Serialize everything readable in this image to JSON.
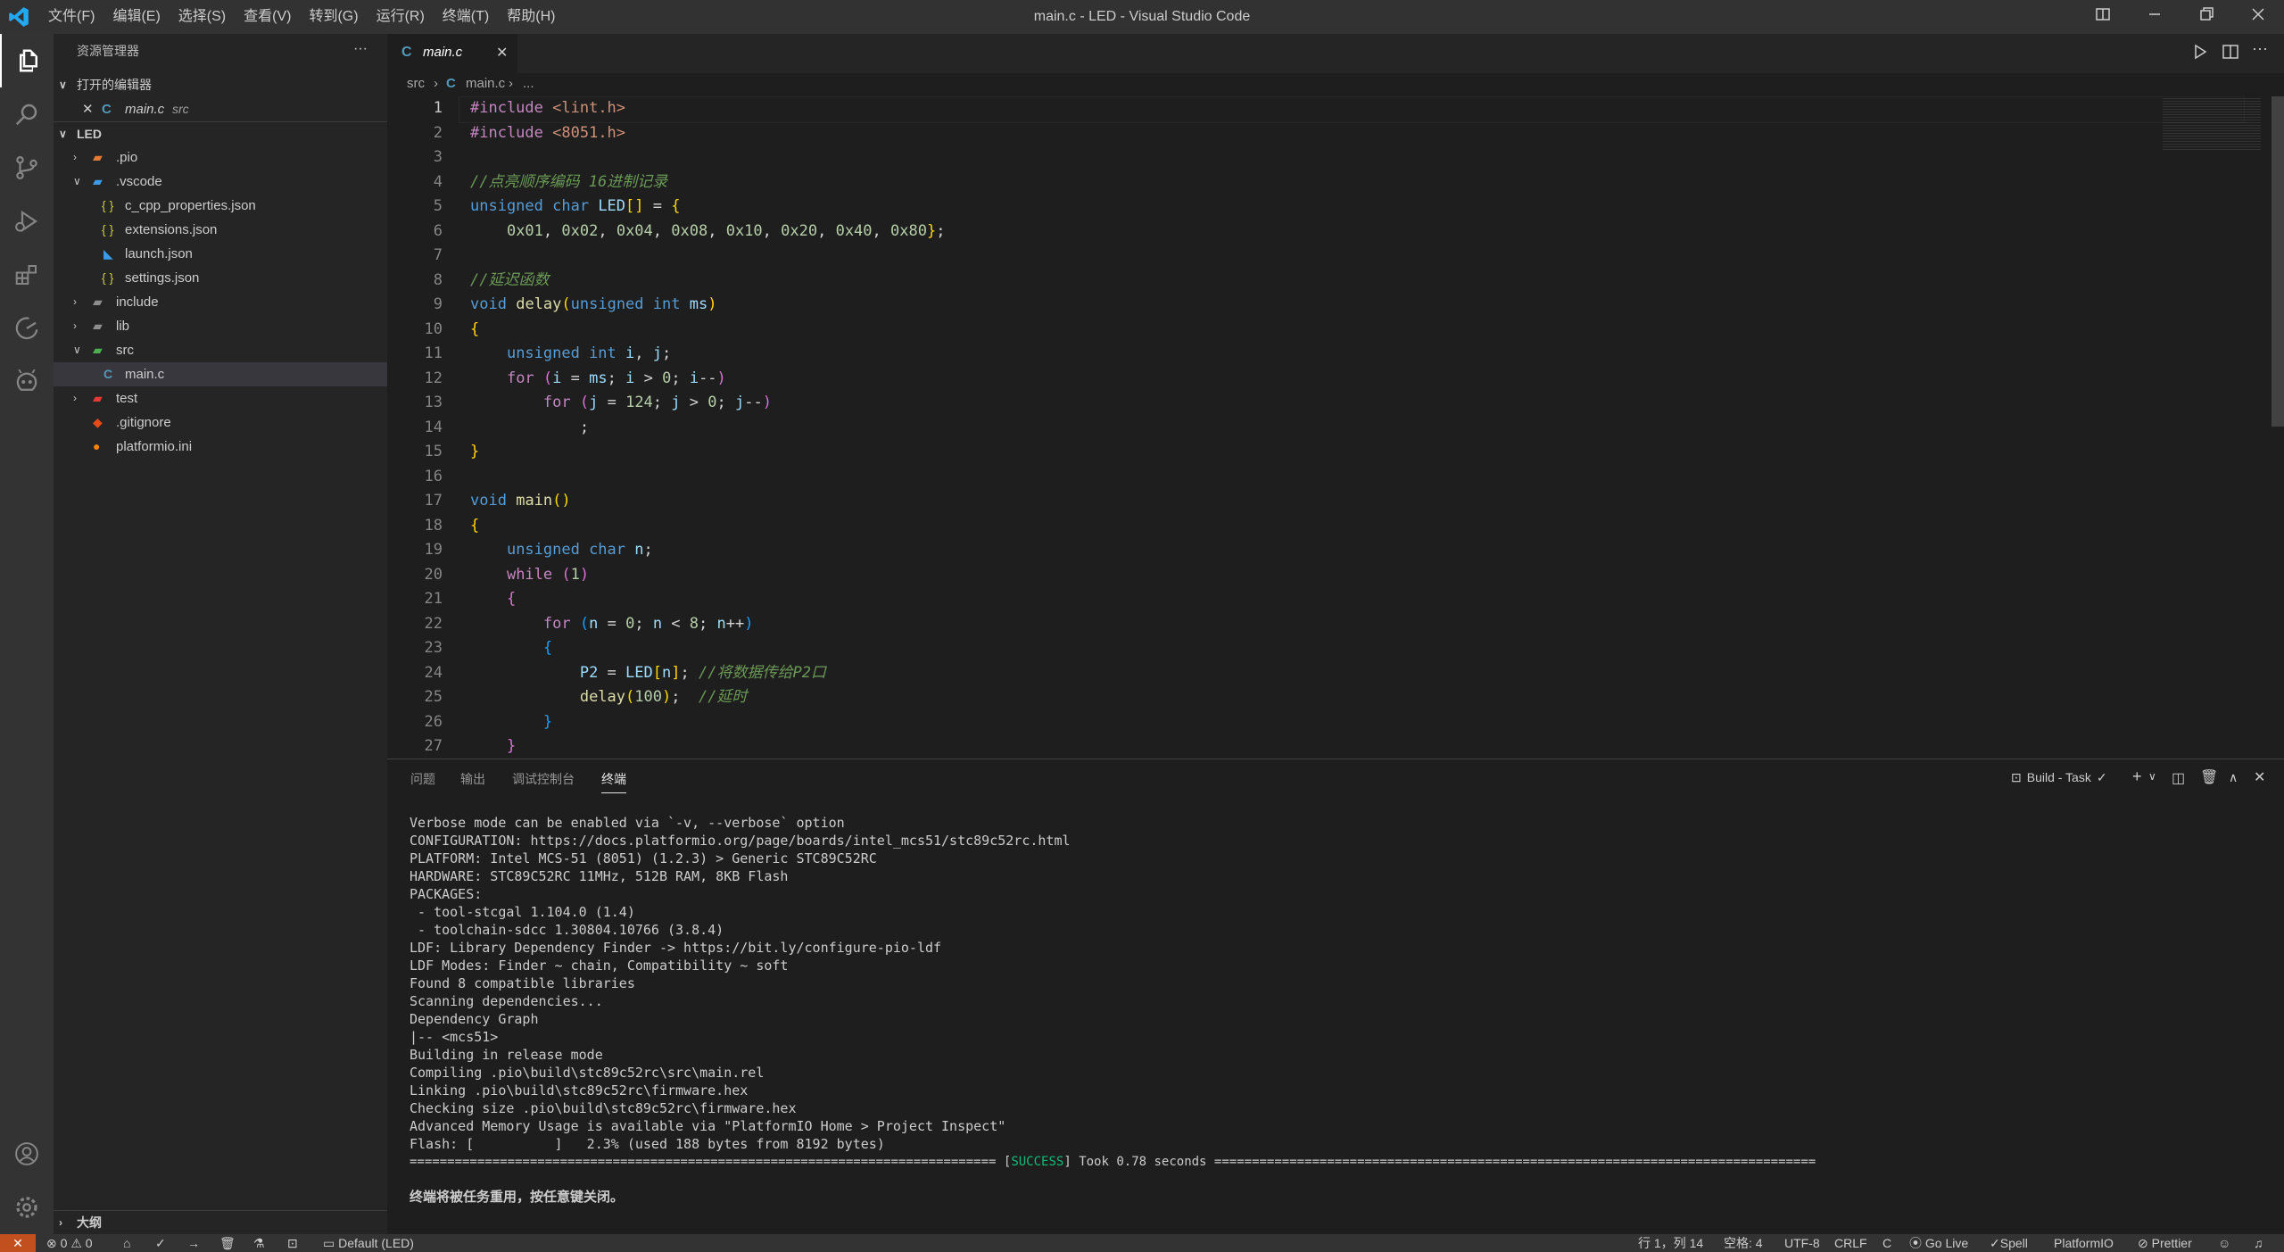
{
  "window": {
    "title": "main.c - LED - Visual Studio Code",
    "menu": [
      "文件(F)",
      "编辑(E)",
      "选择(S)",
      "查看(V)",
      "转到(G)",
      "运行(R)",
      "终端(T)",
      "帮助(H)"
    ],
    "accent": "#007acc",
    "statusbar_remote_color": "#16825d"
  },
  "activity_icons": [
    "explorer-icon",
    "search-icon",
    "source-control-icon",
    "run-debug-icon",
    "extensions-icon",
    "remote-icon",
    "platformio-icon",
    "account-icon",
    "settings-gear-icon"
  ],
  "sidebar": {
    "title": "资源管理器",
    "more": "···",
    "open_editors_label": "打开的编辑器",
    "open_editor": {
      "name": "main.c",
      "path": "src"
    },
    "project_label": "LED",
    "tree": [
      {
        "label": ".pio",
        "kind": "folder",
        "expanded": false
      },
      {
        "label": ".vscode",
        "kind": "folder",
        "expanded": true
      },
      {
        "label": "c_cpp_properties.json",
        "kind": "json"
      },
      {
        "label": "extensions.json",
        "kind": "json"
      },
      {
        "label": "launch.json",
        "kind": "vscode"
      },
      {
        "label": "settings.json",
        "kind": "json"
      },
      {
        "label": "include",
        "kind": "folder",
        "expanded": false
      },
      {
        "label": "lib",
        "kind": "folder",
        "expanded": false
      },
      {
        "label": "src",
        "kind": "folder",
        "expanded": true
      },
      {
        "label": "main.c",
        "kind": "c"
      },
      {
        "label": "test",
        "kind": "folder",
        "expanded": false
      },
      {
        "label": ".gitignore",
        "kind": "git"
      },
      {
        "label": "platformio.ini",
        "kind": "pio"
      }
    ],
    "outline_label": "大纲"
  },
  "editor": {
    "tab": "main.c",
    "breadcrumb": [
      "src",
      "main.c",
      "..."
    ],
    "code_lines": [
      "#include <lint.h>",
      "#include <8051.h>",
      "",
      "//点亮顺序编码 16进制记录",
      "unsigned char LED[] = {",
      "    0x01, 0x02, 0x04, 0x08, 0x10, 0x20, 0x40, 0x80};",
      "",
      "//延迟函数",
      "void delay(unsigned int ms)",
      "{",
      "    unsigned int i, j;",
      "    for (i = ms; i > 0; i--)",
      "        for (j = 124; j > 0; j--)",
      "            ;",
      "}",
      "",
      "void main()",
      "{",
      "    unsigned char n;",
      "    while (1)",
      "    {",
      "        for (n = 0; n < 8; n++)",
      "        {",
      "            P2 = LED[n]; //将数据传给P2口",
      "            delay(100);  //延时",
      "        }",
      "    }"
    ]
  },
  "panel": {
    "tabs": [
      "问题",
      "输出",
      "调试控制台",
      "终端"
    ],
    "active_tab": "终端",
    "task_label": "Build - Task",
    "terminal_lines": [
      "Verbose mode can be enabled via `-v, --verbose` option",
      "CONFIGURATION: https://docs.platformio.org/page/boards/intel_mcs51/stc89c52rc.html",
      "PLATFORM: Intel MCS-51 (8051) (1.2.3) > Generic STC89C52RC",
      "HARDWARE: STC89C52RC 11MHz, 512B RAM, 8KB Flash",
      "PACKAGES:",
      " - tool-stcgal 1.104.0 (1.4)",
      " - toolchain-sdcc 1.30804.10766 (3.8.4)",
      "LDF: Library Dependency Finder -> https://bit.ly/configure-pio-ldf",
      "LDF Modes: Finder ~ chain, Compatibility ~ soft",
      "Found 8 compatible libraries",
      "Scanning dependencies...",
      "Dependency Graph",
      "|-- <mcs51>",
      "Building in release mode",
      "Compiling .pio\\build\\stc89c52rc\\src\\main.rel",
      "Linking .pio\\build\\stc89c52rc\\firmware.hex",
      "Checking size .pio\\build\\stc89c52rc\\firmware.hex",
      "Advanced Memory Usage is available via \"PlatformIO Home > Project Inspect\"",
      "Flash: [          ]   2.3% (used 188 bytes from 8192 bytes)"
    ],
    "success_rule_left": "==============================================================================",
    "success_tag": "SUCCESS",
    "success_text": "Took 0.78 seconds",
    "success_rule_right": "================================================================================",
    "close_msg": "终端将被任务重用，按任意键关闭。"
  },
  "statusbar": {
    "errors": "0",
    "warnings": "0",
    "env": "Default (LED)",
    "position": "行 1，列 14",
    "spaces": "空格: 4",
    "encoding": "UTF-8",
    "eol": "CRLF",
    "language": "C",
    "golive": "Go Live",
    "spell": "Spell",
    "platformio": "PlatformIO",
    "prettier": "Prettier"
  }
}
